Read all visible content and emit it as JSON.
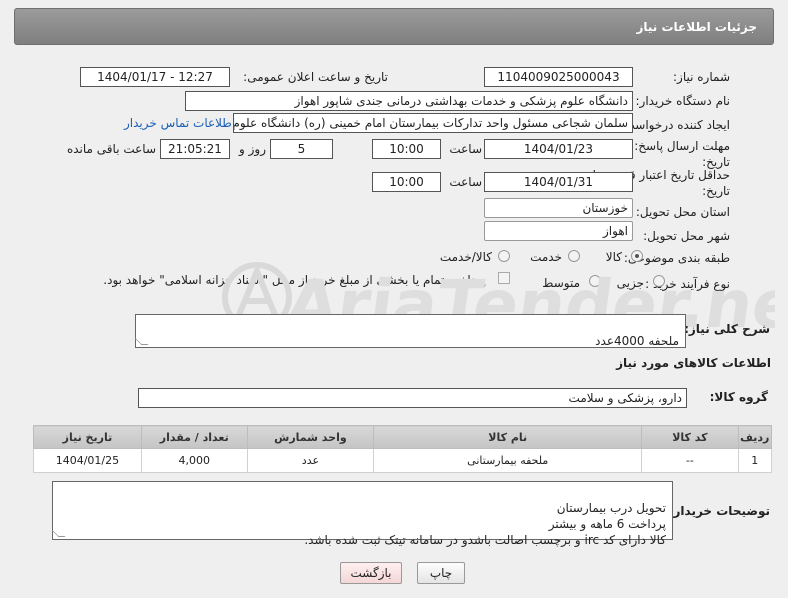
{
  "header": {
    "title": "جزئیات اطلاعات نیاز"
  },
  "labels": {
    "need_number": "شماره نیاز:",
    "announce_datetime": "تاریخ و ساعت اعلان عمومی:",
    "buyer_org": "نام دستگاه خریدار:",
    "requester": "ایجاد کننده درخواست:",
    "reply_deadline": "مهلت ارسال پاسخ: تا تاریخ:",
    "price_validity": "حداقل تاریخ اعتبار قیمت: تا تاریخ:",
    "delivery_province": "استان محل تحویل:",
    "delivery_city": "شهر محل تحویل:",
    "category": "طبقه بندی موضوعی:",
    "process_type": "نوع فرآیند خرید :",
    "time1": "ساعت",
    "time2": "ساعت",
    "days_and": "روز و",
    "remaining": "ساعت باقی مانده",
    "general_desc": "شرح کلی نیاز:",
    "goods_info": "اطلاعات کالاهای مورد نیاز",
    "goods_group": "گروه کالا:",
    "buyer_notes": "توضیحات خریدار:"
  },
  "fields": {
    "need_number": "1104009025000043",
    "announce_datetime": "1404/01/17 - 12:27",
    "buyer_org": "دانشگاه علوم پزشکی و خدمات بهداشتی درمانی جندی شاپور اهواز",
    "requester": "سلمان شجاعی مسئول واحد تدارکات بیمارستان امام خمینی (ره) دانشگاه علوم",
    "contact_link": "اطلاعات تماس خریدار",
    "reply_date": "1404/01/23",
    "reply_time": "10:00",
    "reply_days": "5",
    "reply_remaining": "21:05:21",
    "validity_date": "1404/01/31",
    "validity_time": "10:00",
    "province": "خوزستان",
    "city": "اهواز",
    "general_desc": "ملحفه 4000عدد",
    "goods_group": "دارو، پزشکی و سلامت"
  },
  "category_options": {
    "goods": "کالا",
    "service": "خدمت",
    "goods_service": "کالا/خدمت",
    "selected": "کالا"
  },
  "process_options": {
    "minor": "جزیی",
    "medium": "متوسط",
    "note": "پرداخت تمام یا بخشی از مبلغ خرید،از محل \"اسناد خزانه اسلامی\" خواهد بود."
  },
  "table": {
    "headers": [
      "ردیف",
      "کد کالا",
      "نام کالا",
      "واحد شمارش",
      "تعداد / مقدار",
      "تاریخ نیاز"
    ],
    "rows": [
      [
        "1",
        "--",
        "ملحفه بیمارستانی",
        "عدد",
        "4,000",
        "1404/01/25"
      ]
    ]
  },
  "buyer_notes": "تحویل درب بیمارستان\nپرداخت 6 ماهه و بیشتر\nکالا دارای کد irc و برچسب اصالت باشدو در سامانه تیتک ثبت شده باشد.",
  "buttons": {
    "print": "چاپ",
    "back": "بازگشت"
  },
  "watermark": "AriaTender.net"
}
